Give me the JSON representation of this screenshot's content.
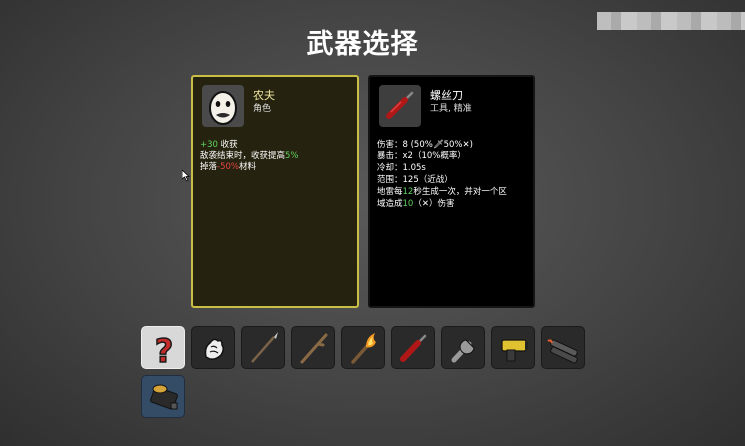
{
  "screen": {
    "title": "武器选择"
  },
  "character": {
    "name": "农夫",
    "subtitle": "角色",
    "stat_value": "+30",
    "stat_label": "收获",
    "line2_pre": "敌袭结束时，收获提高",
    "line2_val": "5%",
    "line3_pre": "掉落",
    "line3_val": "-50%",
    "line3_post": "材料"
  },
  "weapon": {
    "name": "螺丝刀",
    "subtitle": "工具, 精准",
    "damage_line": "伤害：8 (50%🗡50%✕)",
    "crit_line": "暴击：x2（10%概率）",
    "cooldown_line": "冷却：1.05s",
    "range_line": "范围：125（近战）",
    "mine_pre": "地雷每",
    "mine_val": "12",
    "mine_post": "秒生成一次，并对一个区",
    "mine2_pre": "域造成",
    "mine2_val": "10",
    "mine2_post": "（✕）伤害"
  },
  "weapon_slots": [
    {
      "icon": "random-question-icon",
      "state": "selected"
    },
    {
      "icon": "fist-hand-icon",
      "state": "normal"
    },
    {
      "icon": "spear-icon",
      "state": "normal"
    },
    {
      "icon": "stick-icon",
      "state": "normal"
    },
    {
      "icon": "torch-icon",
      "state": "normal"
    },
    {
      "icon": "screwdriver-icon",
      "state": "normal"
    },
    {
      "icon": "wrench-icon",
      "state": "normal"
    },
    {
      "icon": "taser-gun-icon",
      "state": "normal"
    },
    {
      "icon": "double-barrel-gun-icon",
      "state": "normal"
    },
    {
      "icon": "ammo-crate-gun-icon",
      "state": "highlighted"
    }
  ],
  "colors": {
    "character_border": "#c9bf46",
    "positive": "#5fd35f",
    "negative": "#e84444",
    "selected_slot": "#d8d8d8",
    "highlighted_slot": "#354c66"
  }
}
